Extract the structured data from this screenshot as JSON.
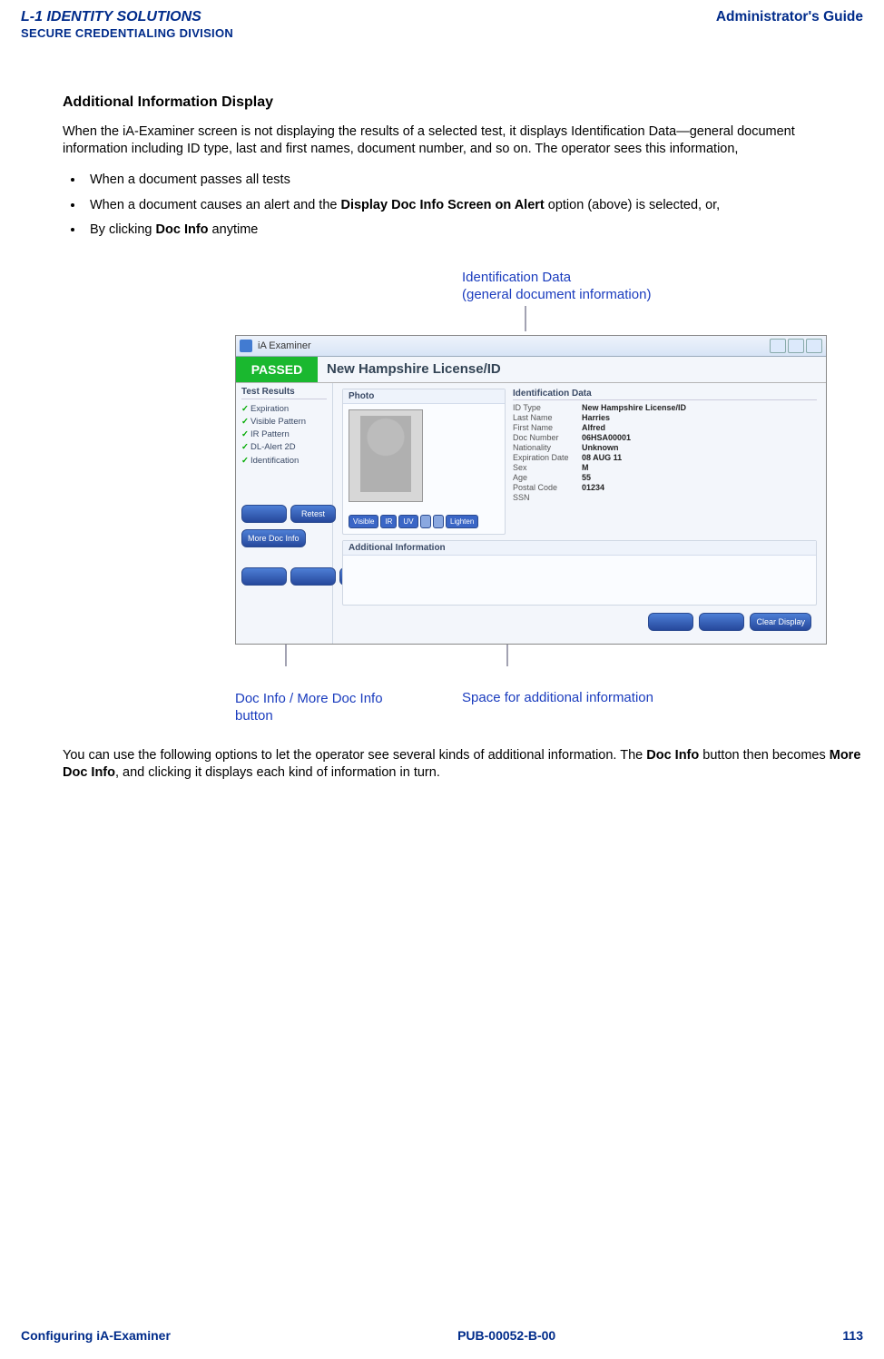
{
  "header": {
    "logo_line1": "L-1 IDENTITY SOLUTIONS",
    "logo_line2": "SECURE CREDENTIALING DIVISION",
    "right": "Administrator's Guide"
  },
  "section_title": "Additional Information Display",
  "intro": "When the iA-Examiner screen is not displaying the results of a selected test, it displays Identification Data—general document information including ID type, last and first names, document number, and so on. The operator sees this information,",
  "bullets": {
    "b0": "When a document passes all tests",
    "b1_pre": "When a document causes an alert and the ",
    "b1_bold": "Display Doc Info Screen on Alert",
    "b1_post": " option (above) is selected, or,",
    "b2_pre": "By clicking ",
    "b2_bold": "Doc Info",
    "b2_post": " anytime"
  },
  "figure": {
    "callout_top_l1": "Identification Data",
    "callout_top_l2": "(general document information)",
    "callout_bottom_left_l1": "Doc Info / More Doc Info",
    "callout_bottom_left_l2": "button",
    "callout_bottom_right": "Space for additional information",
    "app_title": "iA Examiner",
    "passed": "PASSED",
    "doc_title": "New Hampshire License/ID",
    "sidebar_header": "Test Results",
    "tests": [
      "Expiration",
      "Visible Pattern",
      "IR Pattern",
      "DL-Alert 2D",
      "Identification"
    ],
    "btn_retest": "Retest",
    "btn_more_doc": "More Doc Info",
    "photo_label": "Photo",
    "id_header": "Identification Data",
    "id_fields": {
      "l0": "ID Type",
      "v0": "New Hampshire License/ID",
      "l1": "Last Name",
      "v1": "Harries",
      "l2": "First Name",
      "v2": "Alfred",
      "l3": "Doc Number",
      "v3": "06HSA00001",
      "l4": "Nationality",
      "v4": "Unknown",
      "l5": "Expiration Date",
      "v5": "08 AUG 11",
      "l6": "Sex",
      "v6": "M",
      "l7": "Age",
      "v7": "55",
      "l8": "Postal Code",
      "v8": "01234",
      "l9": "SSN",
      "v9": ""
    },
    "photo_btn_visible": "Visible",
    "photo_btn_ir": "IR",
    "photo_btn_uv": "UV",
    "photo_btn_lighten": "Lighten",
    "add_info_label": "Additional Information",
    "btn_clear": "Clear Display"
  },
  "outro_pre": "You can use the following options to let the operator see several kinds of additional information. The ",
  "outro_b1": "Doc Info",
  "outro_mid": " button then becomes ",
  "outro_b2": "More Doc Info",
  "outro_post": ", and clicking it displays each kind of information in turn.",
  "footer": {
    "left": "Configuring iA-Examiner",
    "center": "PUB-00052-B-00",
    "right": "113"
  }
}
